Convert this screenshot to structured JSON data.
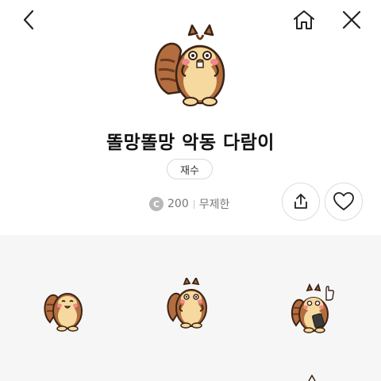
{
  "nav": {
    "back_icon": "chevron-left-icon",
    "home_icon": "home-icon",
    "close_icon": "close-icon"
  },
  "product": {
    "title": "똘망똘망 악동 다람이",
    "tag": "재수",
    "coin_symbol": "C",
    "price": "200",
    "duration": "무제한"
  },
  "actions": {
    "share_icon": "share-icon",
    "like_icon": "heart-outline-icon"
  },
  "colors": {
    "squirrel_brown": "#b46d3e",
    "squirrel_cream": "#f6d99e",
    "cheek_pink": "#f08a8a",
    "gallery_bg": "#f6f6f6"
  }
}
